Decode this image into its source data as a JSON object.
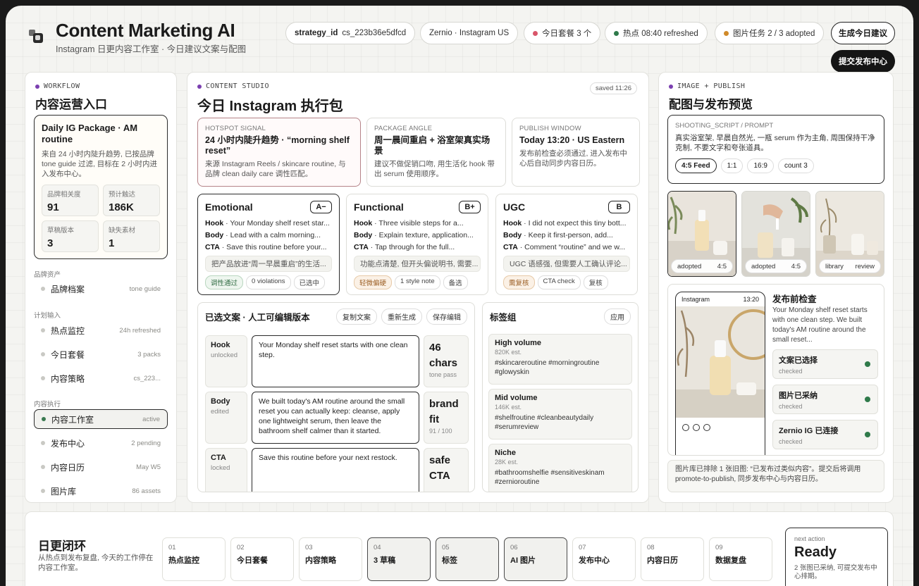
{
  "app": {
    "title": "Content Marketing AI",
    "subtitle": "Instagram 日更内容工作室 · 今日建议文案与配图"
  },
  "header": {
    "strategy_key": "strategy_id",
    "strategy_value": "cs_223b36e5dfcd",
    "account": "Zernio · Instagram US",
    "package_status": "今日套餐 3 个",
    "hotspot_status": "热点 08:40 refreshed",
    "image_status": "图片任务 2 / 3 adopted",
    "generate_button": "生成今日建议",
    "submit_button": "提交发布中心",
    "colors": {
      "package_dot": "#d9556a",
      "hotspot_dot": "#2f7a4a",
      "image_dot": "#d08a2a"
    }
  },
  "workflow": {
    "eyebrow": "WORKFLOW",
    "title": "内容运营入口",
    "package": {
      "title": "Daily IG Package · AM routine",
      "desc": "来自 24 小时内陡升趋势, 已按品牌 tone guide 过滤, 目标在 2 小时内进入发布中心。",
      "stats": [
        {
          "label": "品牌相关度",
          "value": "91"
        },
        {
          "label": "预计触达",
          "value": "186K"
        },
        {
          "label": "草稿版本",
          "value": "3"
        },
        {
          "label": "缺失素材",
          "value": "1"
        }
      ]
    },
    "sections": {
      "brand": "品牌资产",
      "plan": "计划输入",
      "exec": "内容执行"
    },
    "nav": {
      "brand_file": {
        "label": "品牌档案",
        "meta": "tone guide"
      },
      "hotspot": {
        "label": "热点监控",
        "meta": "24h refreshed"
      },
      "daily": {
        "label": "今日套餐",
        "meta": "3 packs"
      },
      "strategy": {
        "label": "内容策略",
        "meta": "cs_223..."
      },
      "studio": {
        "label": "内容工作室",
        "meta": "active"
      },
      "publish": {
        "label": "发布中心",
        "meta": "2 pending"
      },
      "calendar": {
        "label": "内容日历",
        "meta": "May W5"
      },
      "library": {
        "label": "图片库",
        "meta": "86 assets"
      }
    }
  },
  "studio": {
    "eyebrow": "CONTENT STUDIO",
    "title": "今日 Instagram 执行包",
    "saved": "saved 11:26",
    "signals": [
      {
        "key": "HOTSPOT SIGNAL",
        "title": "24 小时内陡升趋势 · “morning shelf reset”",
        "desc": "来源 Instagram Reels / skincare routine, 与品牌 clean daily care 调性匹配。"
      },
      {
        "key": "PACKAGE ANGLE",
        "title": "周一晨间重启 + 浴室架真实场景",
        "desc": "建议不做促销口吻, 用生活化 hook 带出 serum 使用顺序。"
      },
      {
        "key": "PUBLISH WINDOW",
        "title": "Today 13:20 · US Eastern",
        "desc": "发布前检查必须通过, 进入发布中心后自动同步内容日历。"
      }
    ],
    "variants": [
      {
        "name": "Emotional",
        "grade": "A−",
        "hook": "Your Monday shelf reset star...",
        "body": "Lead with a calm morning...",
        "cta": "Save this routine before your...",
        "note": "把产品放进“周一早晨重启”的生活...",
        "tags": [
          "调性通过",
          "0 violations",
          "已选中"
        ]
      },
      {
        "name": "Functional",
        "grade": "B+",
        "hook": "Three visible steps for a...",
        "body": "Explain texture, application...",
        "cta": "Tap through for the full...",
        "note": "功能点清楚, 但开头偏说明书, 需要...",
        "tags": [
          "轻微偏硬",
          "1 style note",
          "备选"
        ]
      },
      {
        "name": "UGC",
        "grade": "B",
        "hook": "I did not expect this tiny bott...",
        "body": "Keep it first-person, add...",
        "cta": "Comment “routine” and we w...",
        "note": "UGC 语感强, 但需要人工确认评论...",
        "tags": [
          "需复核",
          "CTA check",
          "复核"
        ]
      }
    ],
    "field_labels": {
      "hook": "Hook",
      "body": "Body",
      "cta": "CTA"
    },
    "editor": {
      "title": "已选文案 · 人工可编辑版本",
      "copy": "复制文案",
      "regen": "重新生成",
      "save": "保存编辑",
      "rows": [
        {
          "key": "Hook",
          "state": "unlocked",
          "text": "Your Monday shelf reset starts with one clean step.",
          "metric": "46 chars",
          "metric_sub": "tone pass"
        },
        {
          "key": "Body",
          "state": "edited",
          "text": "We built today's AM routine around the small reset you can actually keep: cleanse, apply one lightweight serum, then leave the bathroom shelf calmer than it started.",
          "metric": "brand fit",
          "metric_sub": "91 / 100"
        },
        {
          "key": "CTA",
          "state": "locked",
          "text": "Save this routine before your next restock.",
          "metric": "safe CTA",
          "metric_sub": ""
        }
      ]
    },
    "hashtags": {
      "title": "标签组",
      "apply": "应用",
      "groups": [
        {
          "name": "High volume",
          "est": "820K est.",
          "tags": "#skincareroutine #morningroutine #glowyskin"
        },
        {
          "name": "Mid volume",
          "est": "146K est.",
          "tags": "#shelfroutine #cleanbeautydaily #serumreview"
        },
        {
          "name": "Niche",
          "est": "28K est.",
          "tags": "#bathroomshelfie #sensitiveskinam #zernioroutine"
        }
      ]
    }
  },
  "publish": {
    "eyebrow": "IMAGE + PUBLISH",
    "title": "配图与发布预览",
    "prompt": {
      "key": "SHOOTING_SCRIPT / PROMPT",
      "desc": "真实浴室架, 早晨自然光, 一瓶 serum 作为主角, 周围保持干净克制, 不要文字和夸张道具。",
      "chips": [
        "4:5 Feed",
        "1:1",
        "16:9",
        "count 3"
      ]
    },
    "images": [
      {
        "status": "adopted",
        "ratio": "4:5"
      },
      {
        "status": "adopted",
        "ratio": "4:5"
      },
      {
        "status": "library",
        "ratio": "review"
      }
    ],
    "phone": {
      "app": "Instagram",
      "time": "13:20"
    },
    "check": {
      "title": "发布前检查",
      "desc": "Your Monday shelf reset starts with one clean step. We built today's AM routine around the small reset...",
      "items": [
        {
          "label": "文案已选择",
          "state": "checked"
        },
        {
          "label": "图片已采纳",
          "state": "checked"
        },
        {
          "label": "Zernio IG 已连接",
          "state": "checked"
        }
      ]
    },
    "note": "图片库已排除 1 张旧图: “已发布过类似内容”。提交后将调用 promote-to-publish, 同步发布中心与内容日历。"
  },
  "loop": {
    "title": "日更闭环",
    "desc": "从热点到发布复盘, 今天的工作停在内容工作室。",
    "steps": [
      {
        "n": "01",
        "label": "热点监控",
        "done": false
      },
      {
        "n": "02",
        "label": "今日套餐",
        "done": false
      },
      {
        "n": "03",
        "label": "内容策略",
        "done": false
      },
      {
        "n": "04",
        "label": "3 草稿",
        "done": true
      },
      {
        "n": "05",
        "label": "标签",
        "done": true
      },
      {
        "n": "06",
        "label": "AI 图片",
        "done": true
      },
      {
        "n": "07",
        "label": "发布中心",
        "done": false
      },
      {
        "n": "08",
        "label": "内容日历",
        "done": false
      },
      {
        "n": "09",
        "label": "数据复盘",
        "done": false
      }
    ],
    "next": {
      "key": "next action",
      "value": "Ready",
      "desc": "2 张图已采纳, 可提交发布中心排期。"
    }
  }
}
